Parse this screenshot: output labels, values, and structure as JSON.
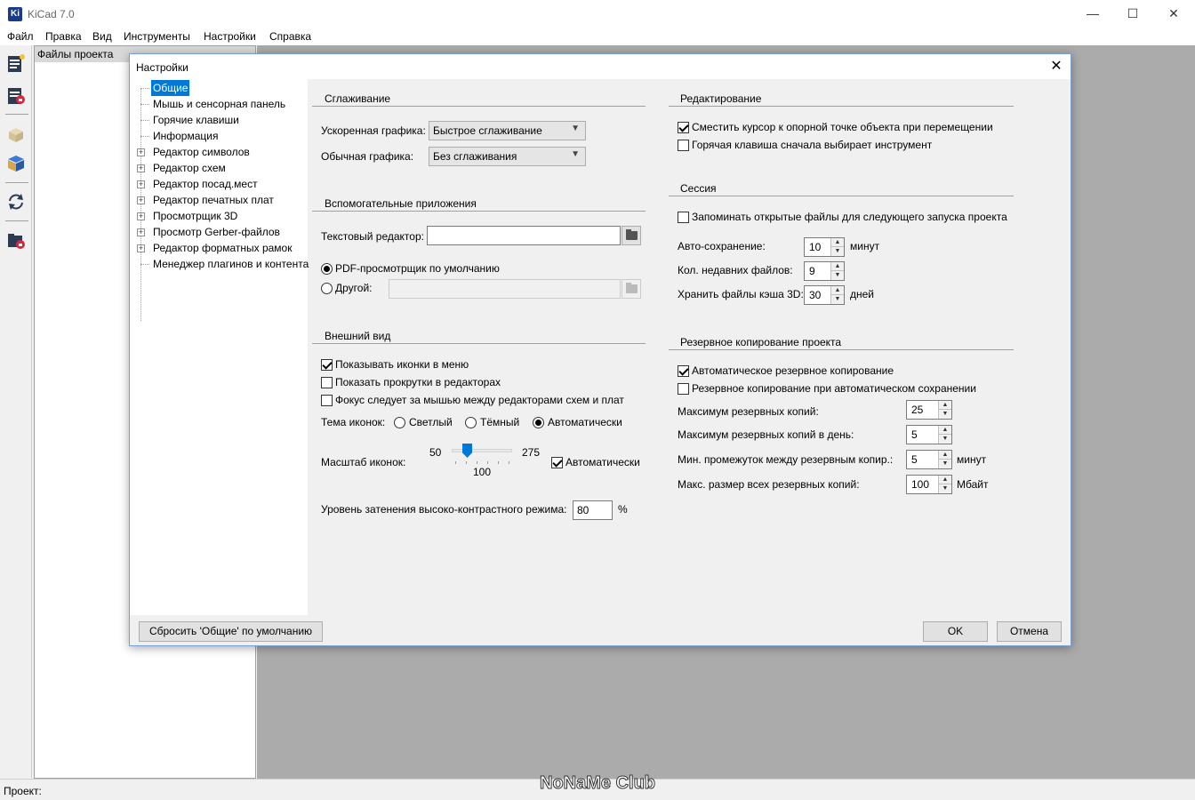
{
  "window": {
    "title": "KiCad 7.0",
    "app_icon_text": "Ki",
    "minimize": "—",
    "maximize": "☐",
    "close": "✕"
  },
  "menu": [
    "Файл",
    "Правка",
    "Вид",
    "Инструменты",
    "Настройки",
    "Справка"
  ],
  "toolbar_icons": [
    "new-project-icon",
    "open-project-icon",
    "3d-box-icon",
    "package-icon",
    "refresh-icon",
    "open-folder-icon"
  ],
  "project_panel": {
    "header": "Файлы проекта"
  },
  "statusbar": {
    "text": "Проект:"
  },
  "watermark": "NoNaMe Club",
  "dialog": {
    "title": "Настройки",
    "close": "✕",
    "tree": [
      {
        "label": "Общие",
        "selected": true,
        "expandable": false
      },
      {
        "label": "Мышь и сенсорная панель",
        "expandable": false
      },
      {
        "label": "Горячие клавиши",
        "expandable": false
      },
      {
        "label": "Информация",
        "expandable": false
      },
      {
        "label": "Редактор символов",
        "expandable": true
      },
      {
        "label": "Редактор схем",
        "expandable": true
      },
      {
        "label": "Редактор посад.мест",
        "expandable": true
      },
      {
        "label": "Редактор печатных плат",
        "expandable": true
      },
      {
        "label": "Просмотрщик 3D",
        "expandable": true
      },
      {
        "label": "Просмотр Gerber-файлов",
        "expandable": true
      },
      {
        "label": "Редактор форматных рамок",
        "expandable": true
      },
      {
        "label": "Менеджер плагинов и контента",
        "expandable": false
      }
    ],
    "antialiasing": {
      "title": "Сглаживание",
      "accelerated_label": "Ускоренная графика:",
      "accelerated_value": "Быстрое сглаживание",
      "fallback_label": "Обычная графика:",
      "fallback_value": "Без сглаживания"
    },
    "helper_apps": {
      "title": "Вспомогательные приложения",
      "text_editor_label": "Текстовый редактор:",
      "text_editor_value": "",
      "pdf_default_label": "PDF-просмотрщик по умолчанию",
      "pdf_other_label": "Другой:",
      "pdf_other_value": ""
    },
    "appearance": {
      "title": "Внешний вид",
      "show_icons_menu": "Показывать иконки в меню",
      "show_scrollbars": "Показать прокрутки в редакторах",
      "focus_follows": "Фокус следует за мышью между редакторами схем и плат",
      "icon_theme_label": "Тема иконок:",
      "theme_light": "Светлый",
      "theme_dark": "Тёмный",
      "theme_auto": "Автоматически",
      "icon_scale_label": "Масштаб иконок:",
      "scale_min": "50",
      "scale_max": "275",
      "scale_value": "100",
      "scale_auto": "Автоматически",
      "hc_label": "Уровень затенения высоко-контрастного режима:",
      "hc_value": "80",
      "hc_unit": "%"
    },
    "editing": {
      "title": "Редактирование",
      "warp_cursor": "Сместить курсор к опорной точке объекта при перемещении",
      "hotkey_tool": "Горячая клавиша сначала выбирает инструмент"
    },
    "session": {
      "title": "Сессия",
      "remember_files": "Запоминать открытые файлы для следующего запуска проекта",
      "autosave_label": "Авто-сохранение:",
      "autosave_value": "10",
      "autosave_unit": "минут",
      "recent_label": "Кол. недавних файлов:",
      "recent_value": "9",
      "cache_label": "Хранить файлы кэша 3D:",
      "cache_value": "30",
      "cache_unit": "дней"
    },
    "backup": {
      "title": "Резервное копирование проекта",
      "auto_backup": "Автоматическое резервное копирование",
      "backup_on_autosave": "Резервное копирование при автоматическом сохранении",
      "max_total_label": "Максимум резервных копий:",
      "max_total_value": "25",
      "max_daily_label": "Максимум резервных копий в день:",
      "max_daily_value": "5",
      "min_interval_label": "Мин. промежуток между резервным копир.:",
      "min_interval_value": "5",
      "min_interval_unit": "минут",
      "max_size_label": "Макс. размер всех резервных копий:",
      "max_size_value": "100",
      "max_size_unit": "Мбайт"
    },
    "buttons": {
      "reset": "Сбросить 'Общие' по умолчанию",
      "ok": "OK",
      "cancel": "Отмена"
    }
  }
}
